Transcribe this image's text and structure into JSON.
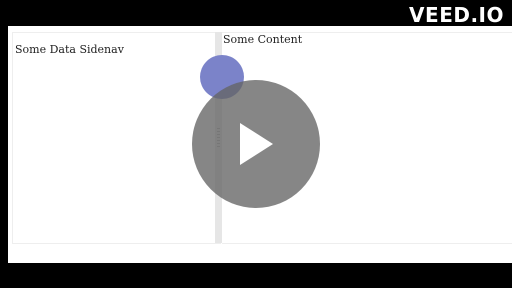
{
  "watermark": "VEED.IO",
  "sidenav": {
    "label": "Some Data Sidenav"
  },
  "content": {
    "label": "Some Content"
  },
  "player": {
    "play_icon": "play-icon"
  },
  "colors": {
    "accent_circle": "#7b83c9",
    "splitter": "#e6e6e6",
    "overlay": "#646464"
  }
}
